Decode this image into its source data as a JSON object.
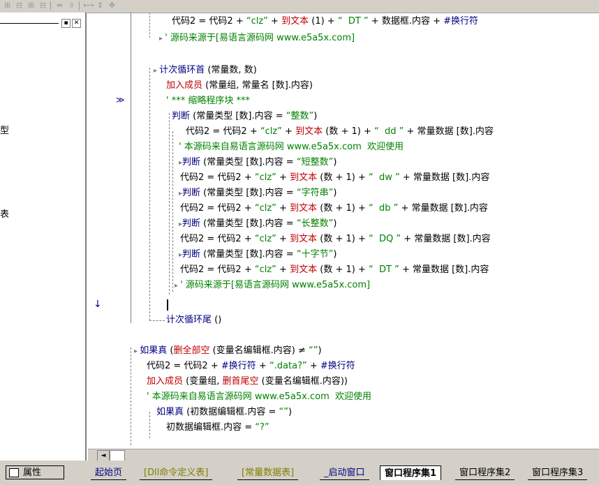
{
  "toolbar": {
    "icons": [
      "grid-icon",
      "grid-icon",
      "grid-icon",
      "grid-icon",
      "align-icon",
      "align-icon",
      "resize-icon",
      "resize-icon",
      "resize-icon"
    ]
  },
  "left_pane": {
    "partial_items": [
      "型",
      "表"
    ]
  },
  "gutter": {
    "current_marker": "≫",
    "down_arrow": "↓"
  },
  "code_lines": [
    {
      "id": "l1",
      "tokens": [
        [
          "n",
          "代码2 = 代码2 + "
        ],
        [
          "s",
          "“clz”"
        ],
        [
          "n",
          " + "
        ],
        [
          "f",
          "到文本"
        ],
        [
          "n",
          " (1) + "
        ],
        [
          "s",
          "“  DT ”"
        ],
        [
          "n",
          " + "
        ],
        [
          "n",
          "数据框.内容 + "
        ],
        [
          "k",
          "#换行符"
        ]
      ]
    },
    {
      "id": "l2",
      "tokens": [
        [
          "c",
          "' 源码来源于[易语言源码网 www.e5a5x.com]"
        ]
      ]
    },
    {
      "id": "l3",
      "tokens": [
        [
          "k",
          "计次循环首"
        ],
        [
          "n",
          " (常量数, 数)"
        ]
      ]
    },
    {
      "id": "l4",
      "tokens": [
        [
          "f",
          "加入成员"
        ],
        [
          "n",
          " (常量组, 常量名 [数].内容)"
        ]
      ]
    },
    {
      "id": "l5",
      "tokens": [
        [
          "c",
          "' *** 缩略程序块 ***"
        ]
      ]
    },
    {
      "id": "l6",
      "tokens": [
        [
          "k",
          "判断"
        ],
        [
          "n",
          " (常量类型 [数].内容 = "
        ],
        [
          "s",
          "“整数”"
        ],
        [
          "n",
          ")"
        ]
      ]
    },
    {
      "id": "l7",
      "tokens": [
        [
          "n",
          "代码2 = 代码2 + "
        ],
        [
          "s",
          "“clz”"
        ],
        [
          "n",
          " + "
        ],
        [
          "f",
          "到文本"
        ],
        [
          "n",
          " (数 + 1) + "
        ],
        [
          "s",
          "“  dd ”"
        ],
        [
          "n",
          " + 常量数据 [数].内容"
        ]
      ]
    },
    {
      "id": "l8",
      "tokens": [
        [
          "c",
          "' 本源码来自易语言源码网 www.e5a5x.com  欢迎使用"
        ]
      ]
    },
    {
      "id": "l9",
      "tokens": [
        [
          "k",
          "判断"
        ],
        [
          "n",
          " (常量类型 [数].内容 = "
        ],
        [
          "s",
          "“短整数”"
        ],
        [
          "n",
          ")"
        ]
      ]
    },
    {
      "id": "l10",
      "tokens": [
        [
          "n",
          "代码2 = 代码2 + "
        ],
        [
          "s",
          "“clz”"
        ],
        [
          "n",
          " + "
        ],
        [
          "f",
          "到文本"
        ],
        [
          "n",
          " (数 + 1) + "
        ],
        [
          "s",
          "“  dw ”"
        ],
        [
          "n",
          " + 常量数据 [数].内容"
        ]
      ]
    },
    {
      "id": "l11",
      "tokens": [
        [
          "k",
          "判断"
        ],
        [
          "n",
          " (常量类型 [数].内容 = "
        ],
        [
          "s",
          "“字符串”"
        ],
        [
          "n",
          ")"
        ]
      ]
    },
    {
      "id": "l12",
      "tokens": [
        [
          "n",
          "代码2 = 代码2 + "
        ],
        [
          "s",
          "“clz”"
        ],
        [
          "n",
          " + "
        ],
        [
          "f",
          "到文本"
        ],
        [
          "n",
          " (数 + 1) + "
        ],
        [
          "s",
          "“  db ”"
        ],
        [
          "n",
          " + 常量数据 [数].内容"
        ]
      ]
    },
    {
      "id": "l13",
      "tokens": [
        [
          "k",
          "判断"
        ],
        [
          "n",
          " (常量类型 [数].内容 = "
        ],
        [
          "s",
          "“长整数”"
        ],
        [
          "n",
          ")"
        ]
      ]
    },
    {
      "id": "l14",
      "tokens": [
        [
          "n",
          "代码2 = 代码2 + "
        ],
        [
          "s",
          "“clz”"
        ],
        [
          "n",
          " + "
        ],
        [
          "f",
          "到文本"
        ],
        [
          "n",
          " (数 + 1) + "
        ],
        [
          "s",
          "“  DQ ”"
        ],
        [
          "n",
          " + 常量数据 [数].内容"
        ]
      ]
    },
    {
      "id": "l15",
      "tokens": [
        [
          "k",
          "判断"
        ],
        [
          "n",
          " (常量类型 [数].内容 = "
        ],
        [
          "s",
          "“十字节”"
        ],
        [
          "n",
          ")"
        ]
      ]
    },
    {
      "id": "l16",
      "tokens": [
        [
          "n",
          "代码2 = 代码2 + "
        ],
        [
          "s",
          "“clz”"
        ],
        [
          "n",
          " + "
        ],
        [
          "f",
          "到文本"
        ],
        [
          "n",
          " (数 + 1) + "
        ],
        [
          "s",
          "“  DT ”"
        ],
        [
          "n",
          " + 常量数据 [数].内容"
        ]
      ]
    },
    {
      "id": "l17",
      "tokens": [
        [
          "c",
          "' 源码来源于[易语言源码网 www.e5a5x.com]"
        ]
      ]
    },
    {
      "id": "l18",
      "tokens": []
    },
    {
      "id": "l19",
      "tokens": [
        [
          "k",
          "计次循环尾"
        ],
        [
          "n",
          " ()"
        ]
      ]
    },
    {
      "id": "l20",
      "tokens": [
        [
          "k",
          "如果真"
        ],
        [
          "n",
          " ("
        ],
        [
          "f",
          "删全部空"
        ],
        [
          "n",
          " (变量名编辑框.内容) ≠ "
        ],
        [
          "s",
          "“”"
        ],
        [
          "n",
          ")"
        ]
      ]
    },
    {
      "id": "l21",
      "tokens": [
        [
          "n",
          "代码2 = 代码2 + "
        ],
        [
          "k",
          "#换行符"
        ],
        [
          "n",
          " + "
        ],
        [
          "s",
          "“.data?”"
        ],
        [
          "n",
          " + "
        ],
        [
          "k",
          "#换行符"
        ]
      ]
    },
    {
      "id": "l22",
      "tokens": [
        [
          "f",
          "加入成员"
        ],
        [
          "n",
          " (变量组, "
        ],
        [
          "f",
          "删首尾空"
        ],
        [
          "n",
          " (变量名编辑框.内容))"
        ]
      ]
    },
    {
      "id": "l23",
      "tokens": [
        [
          "c",
          "' 本源码来自易语言源码网 www.e5a5x.com  欢迎使用"
        ]
      ]
    },
    {
      "id": "l24",
      "tokens": [
        [
          "k",
          "如果真"
        ],
        [
          "n",
          " (初数据编辑框.内容 = "
        ],
        [
          "s",
          "“”"
        ],
        [
          "n",
          ")"
        ]
      ]
    },
    {
      "id": "l25",
      "tokens": [
        [
          "n",
          "初数据编辑框.内容 = "
        ],
        [
          "s",
          "“?”"
        ]
      ]
    }
  ],
  "scrollbar": {
    "left_arrow": "◄"
  },
  "properties_button": {
    "label": "属性"
  },
  "tabs": [
    {
      "label": "起始页",
      "active": false
    },
    {
      "label": "[Dll命令定义表]",
      "active": false
    },
    {
      "label": "[常量数据表]",
      "active": false
    },
    {
      "label": "_启动窗口",
      "active": false
    },
    {
      "label": "窗口程序集1",
      "active": true
    },
    {
      "label": "窗口程序集2",
      "active": false
    },
    {
      "label": "窗口程序集3",
      "active": false
    }
  ],
  "colors": {
    "normal_text": "#000000",
    "keyword": "#000080",
    "function": "#c00000",
    "string_comment": "#008000",
    "chrome": "#d4d0c8"
  }
}
